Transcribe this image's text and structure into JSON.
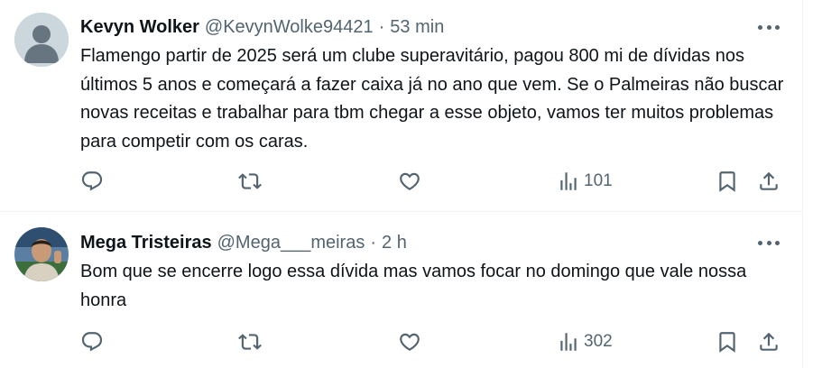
{
  "tweets": [
    {
      "name": "Kevyn Wolker",
      "handle": "@KevynWolke94421",
      "separator": "·",
      "time": "53 min",
      "text": "Flamengo partir de 2025 será um clube superavitário, pagou 800 mi de dívidas nos últimos 5 anos e começará a fazer caixa já no ano que vem. Se o Palmeiras não buscar novas receitas e trabalhar para tbm chegar a esse objeto, vamos ter muitos problemas para competir com os caras.",
      "views": "101",
      "avatar": "default-profile-avatar"
    },
    {
      "name": "Mega Tristeiras",
      "handle": "@Mega___meiras",
      "separator": "·",
      "time": "2 h",
      "text": "Bom que se encerre logo essa dívida mas vamos focar no domingo que vale nossa honra",
      "views": "302",
      "avatar": "photo-avatar"
    }
  ],
  "icons": {
    "reply": "reply-icon",
    "retweet": "retweet-icon",
    "like": "heart-icon",
    "views": "views-chart-icon",
    "bookmark": "bookmark-icon",
    "share": "share-icon",
    "more": "more-options-icon"
  },
  "colors": {
    "text": "#0f1419",
    "secondary": "#536471",
    "border": "#eff3f4",
    "avatar_default": "#ccd6dd"
  }
}
